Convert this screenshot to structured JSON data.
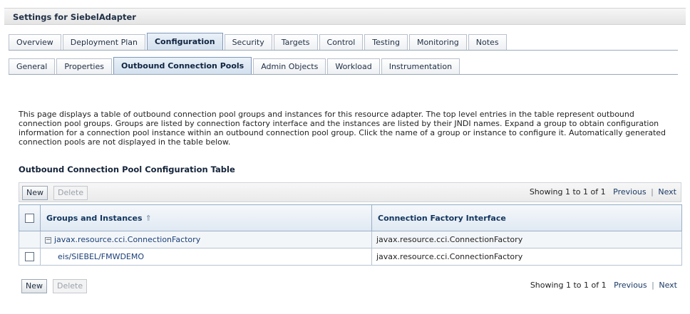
{
  "header": {
    "title": "Settings for SiebelAdapter"
  },
  "primary_tabs": [
    {
      "label": "Overview",
      "active": false
    },
    {
      "label": "Deployment Plan",
      "active": false
    },
    {
      "label": "Configuration",
      "active": true
    },
    {
      "label": "Security",
      "active": false
    },
    {
      "label": "Targets",
      "active": false
    },
    {
      "label": "Control",
      "active": false
    },
    {
      "label": "Testing",
      "active": false
    },
    {
      "label": "Monitoring",
      "active": false
    },
    {
      "label": "Notes",
      "active": false
    }
  ],
  "secondary_tabs": [
    {
      "label": "General",
      "active": false
    },
    {
      "label": "Properties",
      "active": false
    },
    {
      "label": "Outbound Connection Pools",
      "active": true
    },
    {
      "label": "Admin Objects",
      "active": false
    },
    {
      "label": "Workload",
      "active": false
    },
    {
      "label": "Instrumentation",
      "active": false
    }
  ],
  "description": "This page displays a table of outbound connection pool groups and instances for this resource adapter. The top level entries in the table represent outbound connection pool groups. Groups are listed by connection factory interface and the instances are listed by their JNDI names. Expand a group to obtain configuration information for a connection pool instance within an outbound connection pool group. Click the name of a group or instance to configure it. Automatically generated connection pools are not displayed in the table below.",
  "table": {
    "title": "Outbound Connection Pool Configuration Table",
    "new_label": "New",
    "delete_label": "Delete",
    "showing": "Showing 1 to 1 of 1",
    "previous": "Previous",
    "next": "Next",
    "pager_separator": "|",
    "columns": [
      "Groups and Instances",
      "Connection Factory Interface"
    ],
    "sort_icon": "⇑",
    "expand_icon": "−",
    "rows": [
      {
        "name": "javax.resource.cci.ConnectionFactory",
        "interface": "javax.resource.cci.ConnectionFactory",
        "type": "group"
      },
      {
        "name": "eis/SIEBEL/FMWDEMO",
        "interface": "javax.resource.cci.ConnectionFactory",
        "type": "instance"
      }
    ]
  }
}
